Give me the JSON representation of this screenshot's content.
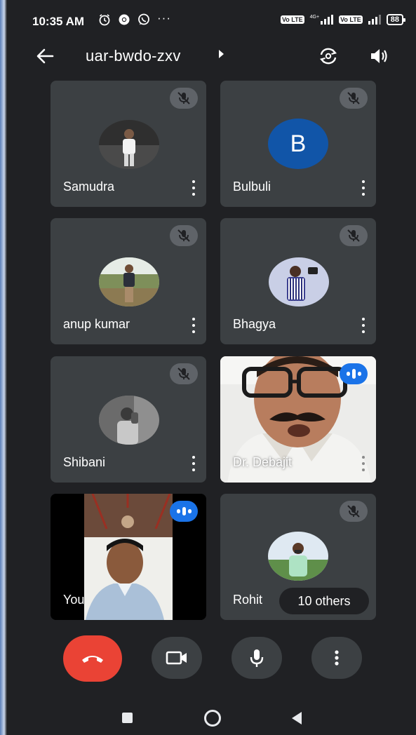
{
  "status_bar": {
    "time": "10:35 AM",
    "left_icons": [
      "alarm-icon",
      "chrome-icon",
      "whatsapp-icon",
      "more-notifications-icon"
    ],
    "more_glyph": "···",
    "sim_label": "Vo LTE",
    "network_label": "4G+",
    "battery": "88"
  },
  "app_bar": {
    "meeting_code": "uar-bwdo-zxv"
  },
  "participants": [
    {
      "name": "Samudra",
      "avatar": "photo",
      "muted": true
    },
    {
      "name": "Bulbuli",
      "avatar": "letter",
      "letter": "B",
      "avatar_color": "#1155a8",
      "muted": true
    },
    {
      "name": "anup kumar",
      "avatar": "photo",
      "muted": true
    },
    {
      "name": "Bhagya",
      "avatar": "photo",
      "muted": true
    },
    {
      "name": "Shibani",
      "avatar": "photo",
      "muted": true
    },
    {
      "name": "Dr. Debajit",
      "avatar": "video",
      "speaking": true
    },
    {
      "name": "You",
      "avatar": "video",
      "speaking": true
    },
    {
      "name": "Rohit",
      "avatar": "photo",
      "muted": true
    }
  ],
  "others_label": "10 others",
  "controls": {
    "end_call_color": "#ea4335",
    "items": [
      "end-call-icon",
      "camera-icon",
      "microphone-icon",
      "more-options-icon"
    ]
  },
  "colors": {
    "background": "#202124",
    "tile": "#3c4043",
    "accent_blue": "#1a73e8"
  }
}
